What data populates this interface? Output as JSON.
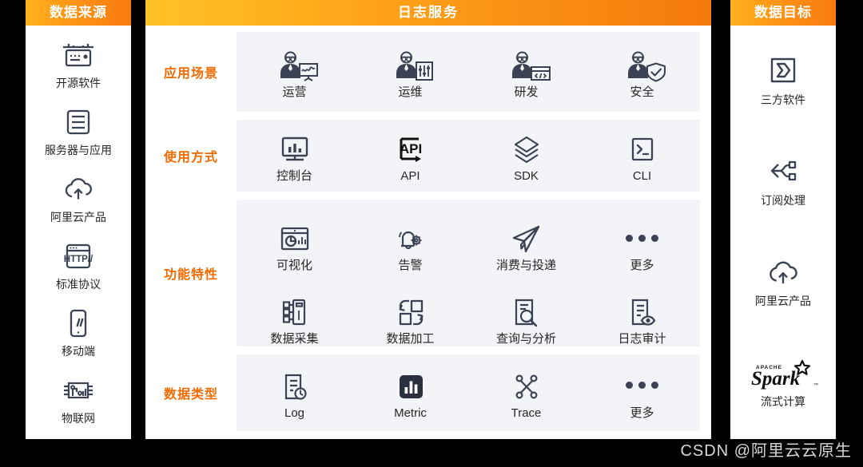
{
  "left_panel": {
    "title": "数据来源",
    "items": [
      {
        "label": "开源软件",
        "icon": "server-rack-icon"
      },
      {
        "label": "服务器与应用",
        "icon": "server-list-icon"
      },
      {
        "label": "阿里云产品",
        "icon": "cloud-upload-icon"
      },
      {
        "label": "标准协议",
        "icon": "http-browser-icon"
      },
      {
        "label": "移动端",
        "icon": "mobile-phone-icon"
      },
      {
        "label": "物联网",
        "icon": "iot-chip-icon"
      }
    ]
  },
  "center_panel": {
    "title": "日志服务",
    "rows": [
      {
        "label": "应用场景",
        "groups": [
          [
            {
              "label": "运营",
              "icon": "person-chart-icon"
            },
            {
              "label": "运维",
              "icon": "person-sliders-icon"
            },
            {
              "label": "研发",
              "icon": "person-code-icon"
            },
            {
              "label": "安全",
              "icon": "person-shield-icon"
            }
          ]
        ]
      },
      {
        "label": "使用方式",
        "groups": [
          [
            {
              "label": "控制台",
              "icon": "console-monitor-icon"
            },
            {
              "label": "API",
              "icon": "api-icon"
            },
            {
              "label": "SDK",
              "icon": "layers-stack-icon"
            },
            {
              "label": "CLI",
              "icon": "terminal-icon"
            }
          ]
        ]
      },
      {
        "label": "功能特性",
        "groups": [
          [
            {
              "label": "可视化",
              "icon": "dashboard-chart-icon"
            },
            {
              "label": "告警",
              "icon": "bell-gear-icon"
            },
            {
              "label": "消费与投递",
              "icon": "paper-plane-icon"
            },
            {
              "label": "更多",
              "icon": "ellipsis-icon"
            }
          ],
          [
            {
              "label": "数据采集",
              "icon": "data-collect-icon"
            },
            {
              "label": "数据加工",
              "icon": "data-transform-icon"
            },
            {
              "label": "查询与分析",
              "icon": "document-search-icon"
            },
            {
              "label": "日志审计",
              "icon": "document-eye-icon"
            }
          ]
        ]
      },
      {
        "label": "数据类型",
        "groups": [
          [
            {
              "label": "Log",
              "icon": "log-clock-icon"
            },
            {
              "label": "Metric",
              "icon": "metric-bars-icon"
            },
            {
              "label": "Trace",
              "icon": "trace-nodes-icon"
            },
            {
              "label": "更多",
              "icon": "ellipsis-icon"
            }
          ]
        ]
      }
    ]
  },
  "right_panel": {
    "title": "数据目标",
    "items": [
      {
        "label": "三方软件",
        "icon": "chevron-box-icon"
      },
      {
        "label": "订阅处理",
        "icon": "share-nodes-icon"
      },
      {
        "label": "阿里云产品",
        "icon": "cloud-upload-icon"
      },
      {
        "label": "流式计算",
        "icon": "apache-spark-logo"
      }
    ]
  },
  "watermark": "CSDN @阿里云云原生",
  "colors": {
    "header_gradient_start": "#ffc227",
    "header_gradient_end": "#f4790c",
    "row_label": "#f56a00",
    "row_box_bg": "#f3f4f8",
    "icon": "#3b4253",
    "panel_bg": "#ffffff",
    "page_bg": "#000000",
    "watermark": "#d8d8d8"
  }
}
